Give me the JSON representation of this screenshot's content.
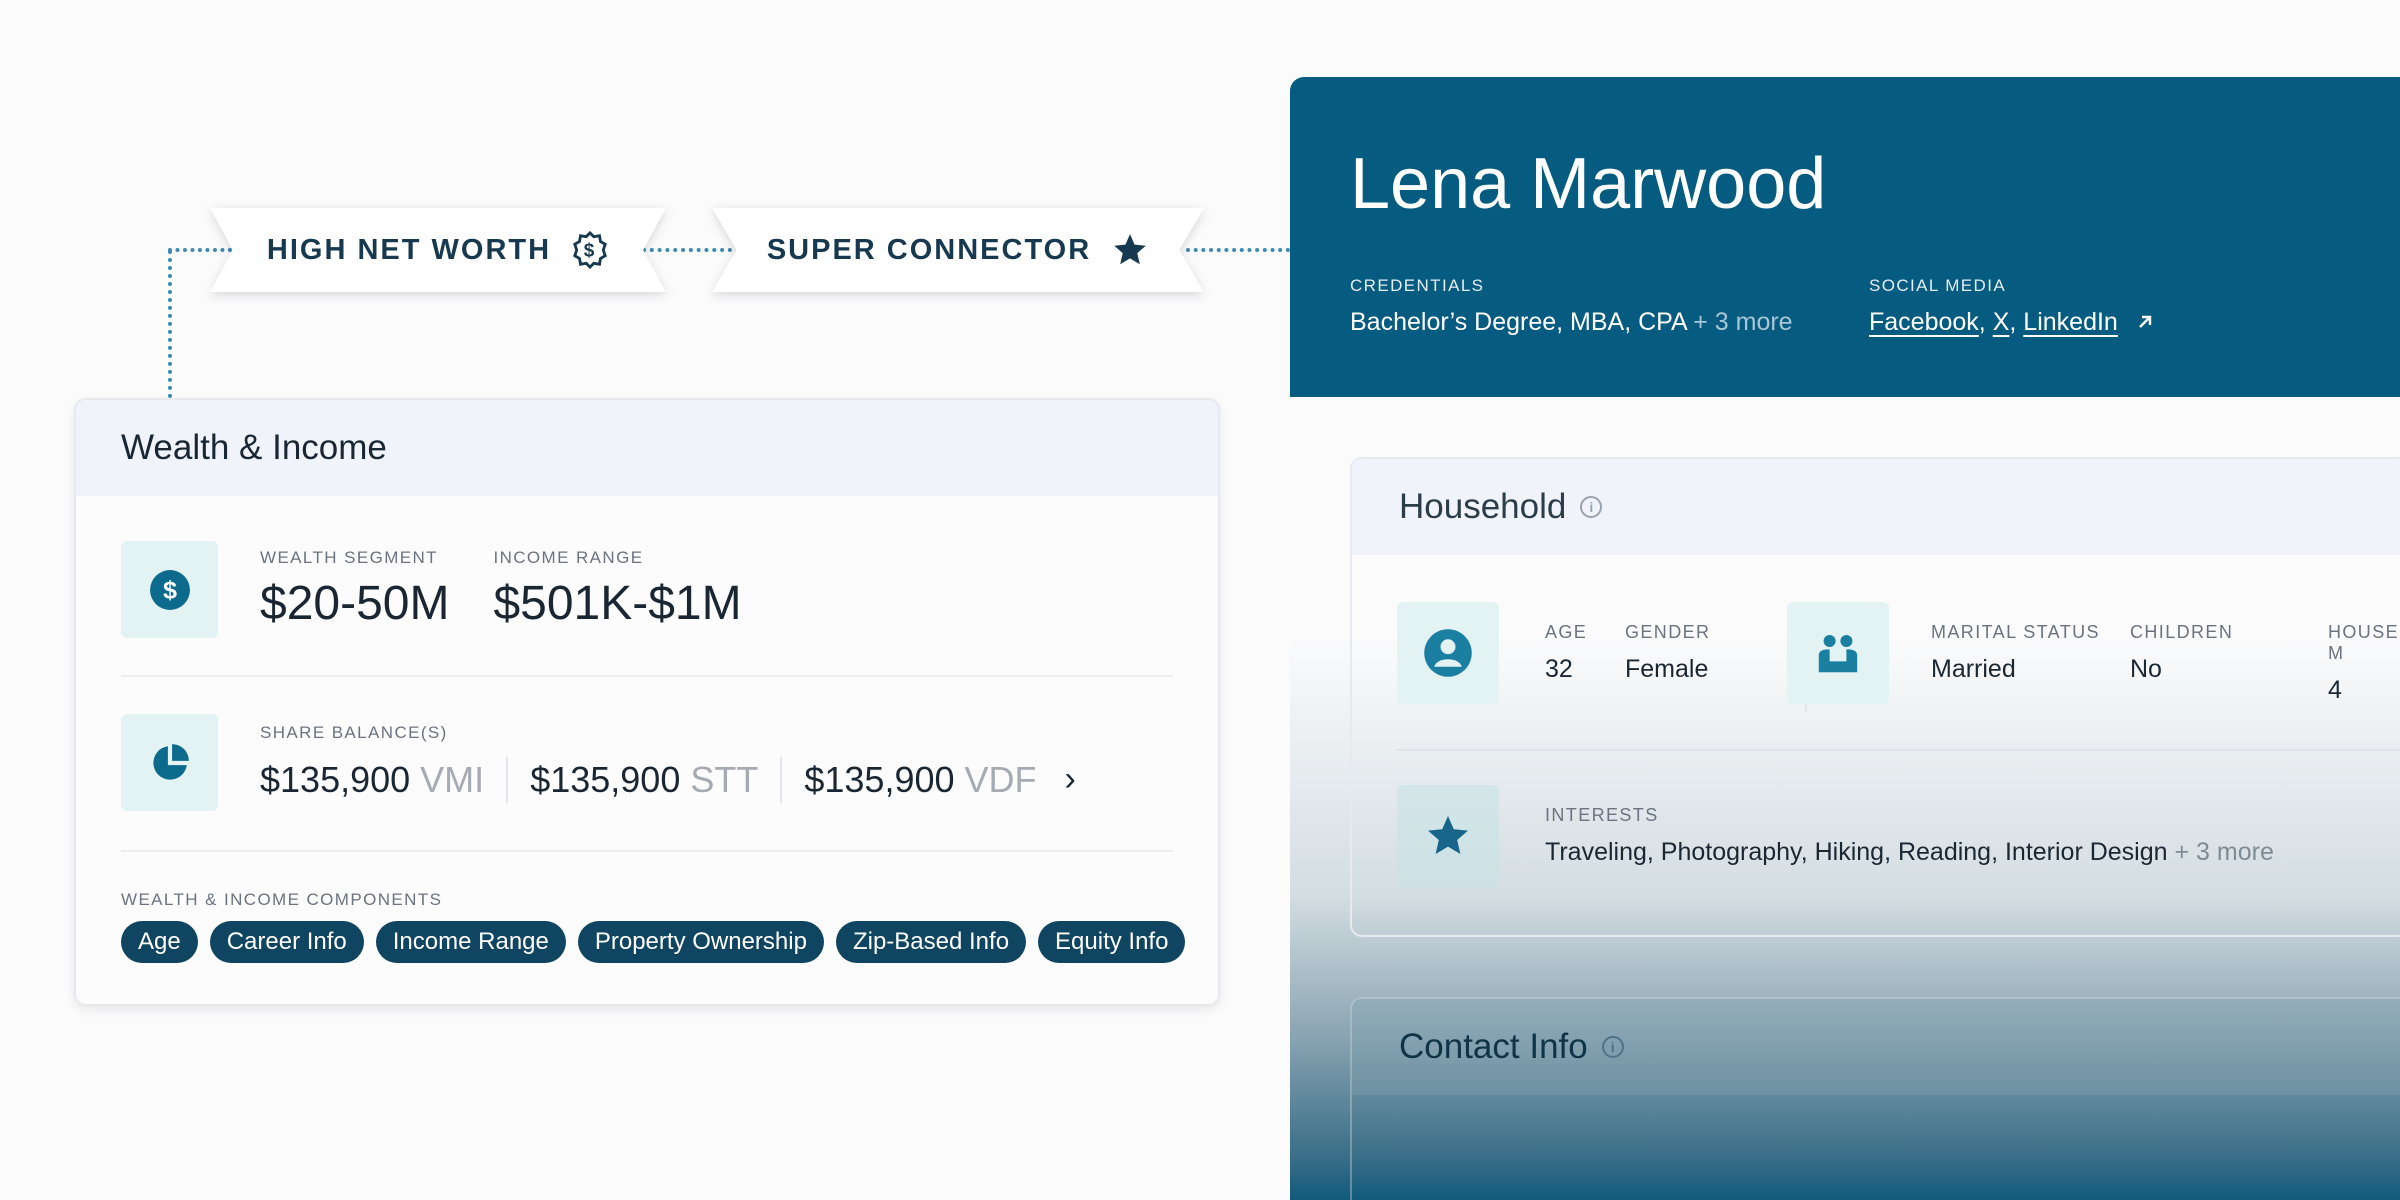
{
  "badges": [
    {
      "label": "HIGH NET WORTH",
      "icon": "dollar-coin-icon"
    },
    {
      "label": "SUPER CONNECTOR",
      "icon": "star-icon"
    }
  ],
  "wealth": {
    "title": "Wealth & Income",
    "segment_label": "WEALTH SEGMENT",
    "segment_value": "$20-50M",
    "income_label": "INCOME RANGE",
    "income_value": "$501K-$1M",
    "shares_label": "SHARE BALANCE(S)",
    "shares": [
      {
        "amount": "$135,900",
        "ticker": "VMI"
      },
      {
        "amount": "$135,900",
        "ticker": "STT"
      },
      {
        "amount": "$135,900",
        "ticker": "VDF"
      }
    ],
    "more_arrow": "›",
    "components_label": "WEALTH & INCOME COMPONENTS",
    "components": [
      "Age",
      "Career Info",
      "Income Range",
      "Property Ownership",
      "Zip-Based Info",
      "Equity Info"
    ]
  },
  "profile": {
    "name": "Lena Marwood",
    "credentials_label": "CREDENTIALS",
    "credentials_value": "Bachelor’s Degree, MBA, CPA",
    "credentials_more": "+ 3 more",
    "social_label": "SOCIAL MEDIA",
    "social_links": [
      "Facebook",
      "X",
      "LinkedIn"
    ],
    "social_sep": ",",
    "household": {
      "title": "Household",
      "info": "i",
      "age_label": "AGE",
      "age_value": "32",
      "gender_label": "GENDER",
      "gender_value": "Female",
      "marital_label": "MARITAL STATUS",
      "marital_value": "Married",
      "children_label": "CHILDREN",
      "children_value": "No",
      "hh_label": "HOUSEHOLD M",
      "hh_value": "4",
      "interests_label": "INTERESTS",
      "interests_value": "Traveling, Photography, Hiking, Reading, Interior Design",
      "interests_more": "+ 3 more"
    },
    "contact": {
      "title": "Contact Info",
      "info": "i"
    }
  },
  "colors": {
    "brand": "#065b80",
    "chip": "#0f4560",
    "connector": "#3d8bb0",
    "tile": "#e3f2f2"
  }
}
